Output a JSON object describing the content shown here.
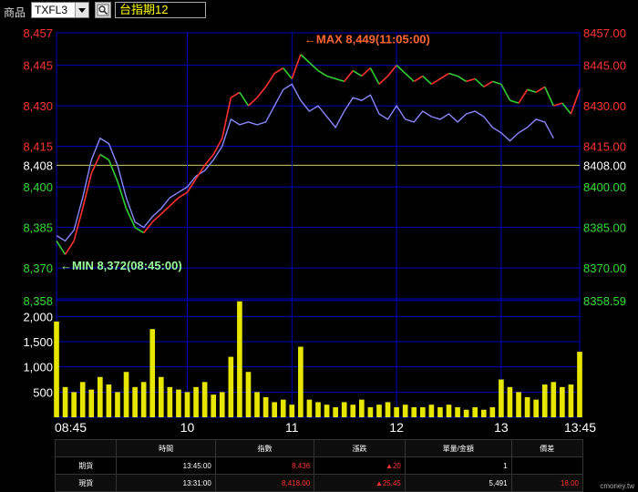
{
  "toolbar": {
    "product_label": "商品",
    "product_value": "TXFL3",
    "index_name": "台指期12"
  },
  "colors": {
    "futures_up": "#ff3030",
    "futures_down": "#33cc33",
    "spot": "#8888ff",
    "volume": "#e6e600",
    "grid": "#0000c0",
    "ref_line": "#cccc66"
  },
  "chart_data": {
    "type": "line",
    "title": "",
    "y_left_ticks": [
      "8,457",
      "8,445",
      "8,430",
      "8,415",
      "8,408",
      "8,400",
      "8,385",
      "8,370",
      "8,358"
    ],
    "y_right_ticks": [
      "8457.00",
      "8445.00",
      "8430.00",
      "8415.00",
      "8408.00",
      "8400.00",
      "8385.00",
      "8370.00",
      "8358.59"
    ],
    "ylim": [
      8358.59,
      8457
    ],
    "reference": 8408,
    "x_ticks": [
      "08:45",
      "10",
      "11",
      "12",
      "13",
      "13:45"
    ],
    "annotations": [
      {
        "text": "←MAX 8,449(11:05:00)",
        "color": "#ff6633"
      },
      {
        "text": "←MIN 8,372(08:45:00)",
        "color": "#99ff99"
      }
    ],
    "series": [
      {
        "kind": "futures",
        "x": [
          "08:45",
          "08:50",
          "08:55",
          "09:00",
          "09:05",
          "09:10",
          "09:15",
          "09:20",
          "09:25",
          "09:30",
          "09:35",
          "09:40",
          "09:45",
          "09:50",
          "09:55",
          "10:00",
          "10:05",
          "10:10",
          "10:15",
          "10:20",
          "10:25",
          "10:30",
          "10:35",
          "10:40",
          "10:45",
          "10:50",
          "10:55",
          "11:00",
          "11:05",
          "11:10",
          "11:15",
          "11:20",
          "11:25",
          "11:30",
          "11:35",
          "11:40",
          "11:45",
          "11:50",
          "11:55",
          "12:00",
          "12:05",
          "12:10",
          "12:15",
          "12:20",
          "12:25",
          "12:30",
          "12:35",
          "12:40",
          "12:45",
          "12:50",
          "12:55",
          "13:00",
          "13:05",
          "13:10",
          "13:15",
          "13:20",
          "13:25",
          "13:30",
          "13:35",
          "13:40",
          "13:45"
        ],
        "values": [
          8380,
          8375,
          8380,
          8392,
          8405,
          8412,
          8410,
          8402,
          8392,
          8385,
          8383,
          8387,
          8390,
          8393,
          8396,
          8398,
          8403,
          8408,
          8412,
          8418,
          8433,
          8435,
          8430,
          8433,
          8437,
          8442,
          8444,
          8440,
          8449,
          8446,
          8443,
          8441,
          8440,
          8439,
          8443,
          8441,
          8444,
          8438,
          8441,
          8445,
          8442,
          8439,
          8441,
          8438,
          8440,
          8442,
          8441,
          8439,
          8440,
          8437,
          8439,
          8438,
          8432,
          8431,
          8436,
          8435,
          8437,
          8430,
          8431,
          8427,
          8436
        ]
      },
      {
        "kind": "spot",
        "x": [
          "08:45",
          "08:50",
          "08:55",
          "09:00",
          "09:05",
          "09:10",
          "09:15",
          "09:20",
          "09:25",
          "09:30",
          "09:35",
          "09:40",
          "09:45",
          "09:50",
          "09:55",
          "10:00",
          "10:05",
          "10:10",
          "10:15",
          "10:20",
          "10:25",
          "10:30",
          "10:35",
          "10:40",
          "10:45",
          "10:50",
          "10:55",
          "11:00",
          "11:05",
          "11:10",
          "11:15",
          "11:20",
          "11:25",
          "11:30",
          "11:35",
          "11:40",
          "11:45",
          "11:50",
          "11:55",
          "12:00",
          "12:05",
          "12:10",
          "12:15",
          "12:20",
          "12:25",
          "12:30",
          "12:35",
          "12:40",
          "12:45",
          "12:50",
          "12:55",
          "13:00",
          "13:05",
          "13:10",
          "13:15",
          "13:20",
          "13:25",
          "13:30"
        ],
        "values": [
          8382,
          8380,
          8384,
          8396,
          8410,
          8418,
          8416,
          8408,
          8396,
          8387,
          8385,
          8389,
          8392,
          8396,
          8398,
          8400,
          8404,
          8406,
          8410,
          8415,
          8425,
          8423,
          8424,
          8423,
          8424,
          8430,
          8436,
          8438,
          8432,
          8428,
          8430,
          8426,
          8422,
          8428,
          8433,
          8432,
          8434,
          8427,
          8425,
          8430,
          8425,
          8424,
          8428,
          8426,
          8425,
          8427,
          8424,
          8427,
          8428,
          8426,
          8422,
          8420,
          8417,
          8420,
          8422,
          8425,
          8424,
          8418
        ]
      }
    ],
    "volume": {
      "y_ticks": [
        "2,000",
        "1,500",
        "1,000",
        "500"
      ],
      "ylim": [
        0,
        2350
      ],
      "x": [
        "08:45",
        "08:50",
        "08:55",
        "09:00",
        "09:05",
        "09:10",
        "09:15",
        "09:20",
        "09:25",
        "09:30",
        "09:35",
        "09:40",
        "09:45",
        "09:50",
        "09:55",
        "10:00",
        "10:05",
        "10:10",
        "10:15",
        "10:20",
        "10:25",
        "10:30",
        "10:35",
        "10:40",
        "10:45",
        "10:50",
        "10:55",
        "11:00",
        "11:05",
        "11:10",
        "11:15",
        "11:20",
        "11:25",
        "11:30",
        "11:35",
        "11:40",
        "11:45",
        "11:50",
        "11:55",
        "12:00",
        "12:05",
        "12:10",
        "12:15",
        "12:20",
        "12:25",
        "12:30",
        "12:35",
        "12:40",
        "12:45",
        "12:50",
        "12:55",
        "13:00",
        "13:05",
        "13:10",
        "13:15",
        "13:20",
        "13:25",
        "13:30",
        "13:35",
        "13:40",
        "13:45"
      ],
      "values": [
        1900,
        600,
        500,
        700,
        550,
        800,
        650,
        500,
        900,
        600,
        700,
        1750,
        800,
        600,
        550,
        500,
        600,
        700,
        450,
        500,
        1200,
        2300,
        900,
        500,
        400,
        300,
        350,
        250,
        1400,
        350,
        300,
        250,
        200,
        300,
        250,
        350,
        200,
        250,
        300,
        200,
        250,
        200,
        200,
        250,
        200,
        250,
        200,
        150,
        200,
        150,
        200,
        750,
        600,
        500,
        400,
        350,
        650,
        700,
        600,
        650,
        1300
      ]
    }
  },
  "table": {
    "headers": [
      "",
      "時間",
      "指數",
      "漲跌",
      "單量/金額",
      "價差"
    ],
    "rows": [
      {
        "name": "期貨",
        "time": "13:45:00",
        "index": "8,436",
        "change": "20",
        "qty": "1",
        "spread": ""
      },
      {
        "name": "現貨",
        "time": "13:31:00",
        "index": "8,418.00",
        "change": "25.45",
        "qty": "5,491",
        "spread": "18.00"
      }
    ]
  },
  "footer": {
    "credit": "cmoney.tw"
  }
}
